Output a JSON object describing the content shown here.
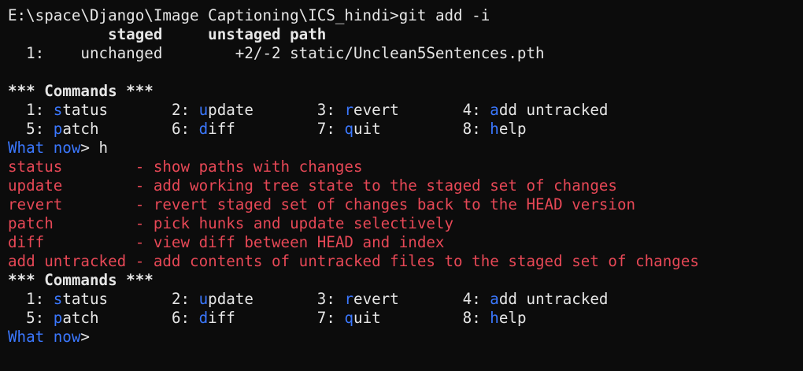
{
  "colors": {
    "background": "#0c0c0c",
    "foreground": "#e6e6e6",
    "prompt_blue": "#3b78ff",
    "help_red": "#e74856"
  },
  "prompt": {
    "path": "E:\\space\\Django\\Image Captioning\\ICS_hindi>",
    "command": "git add -i"
  },
  "status_table": {
    "header": "           staged     unstaged path",
    "row_1": "  1:    unchanged        +2/-2 static/Unclean5Sentences.pth"
  },
  "commands_block_1": {
    "title": "*** Commands ***",
    "items": [
      {
        "num": "  1: ",
        "key": "s",
        "rest": "tatus       "
      },
      {
        "num": "2: ",
        "key": "u",
        "rest": "pdate       "
      },
      {
        "num": "3: ",
        "key": "r",
        "rest": "evert       "
      },
      {
        "num": "4: ",
        "key": "a",
        "rest": "dd untracked"
      },
      {
        "num": "  5: ",
        "key": "p",
        "rest": "atch        "
      },
      {
        "num": "6: ",
        "key": "d",
        "rest": "iff         "
      },
      {
        "num": "7: ",
        "key": "q",
        "rest": "uit         "
      },
      {
        "num": "8: ",
        "key": "h",
        "rest": "elp"
      }
    ]
  },
  "what_now_1": {
    "label": "What now",
    "suffix": "> h"
  },
  "help_lines": [
    "status        - show paths with changes",
    "update        - add working tree state to the staged set of changes",
    "revert        - revert staged set of changes back to the HEAD version",
    "patch         - pick hunks and update selectively",
    "diff          - view diff between HEAD and index",
    "add untracked - add contents of untracked files to the staged set of changes"
  ],
  "commands_block_2": {
    "title": "*** Commands ***",
    "items": [
      {
        "num": "  1: ",
        "key": "s",
        "rest": "tatus       "
      },
      {
        "num": "2: ",
        "key": "u",
        "rest": "pdate       "
      },
      {
        "num": "3: ",
        "key": "r",
        "rest": "evert       "
      },
      {
        "num": "4: ",
        "key": "a",
        "rest": "dd untracked"
      },
      {
        "num": "  5: ",
        "key": "p",
        "rest": "atch        "
      },
      {
        "num": "6: ",
        "key": "d",
        "rest": "iff         "
      },
      {
        "num": "7: ",
        "key": "q",
        "rest": "uit         "
      },
      {
        "num": "8: ",
        "key": "h",
        "rest": "elp"
      }
    ]
  },
  "what_now_2": {
    "label": "What now",
    "suffix": ">"
  }
}
